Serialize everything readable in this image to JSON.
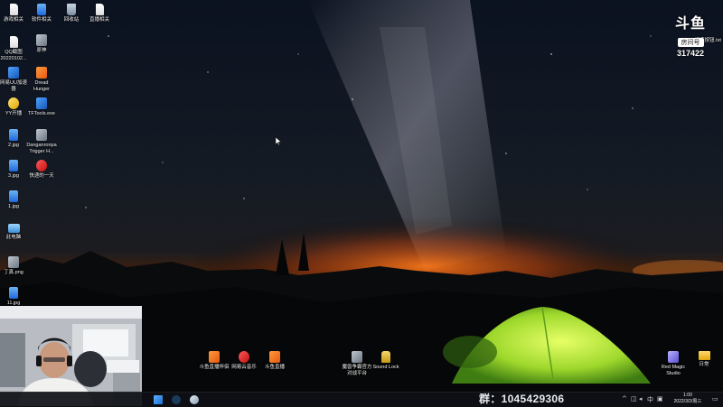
{
  "desktop": {
    "icons_left": [
      {
        "label": "游戏相关",
        "icon": "file-icon",
        "kind": "file"
      },
      {
        "label": "软件相关",
        "icon": "file-icon",
        "kind": "img"
      },
      {
        "label": "回收站",
        "icon": "recycle-bin-icon",
        "kind": "bin"
      },
      {
        "label": "直播相关",
        "icon": "file-icon",
        "kind": "file"
      },
      {
        "label": "QQ截图20220102...",
        "icon": "image-file-icon",
        "kind": "file"
      },
      {
        "label": "原神",
        "icon": "game-icon",
        "kind": "gray"
      },
      {
        "label": "网易UU加速器",
        "icon": "app-icon",
        "kind": "app"
      },
      {
        "label": "Dread Hunger",
        "icon": "game-icon",
        "kind": "orange"
      },
      {
        "label": "YY开播",
        "icon": "app-icon",
        "kind": "yellow"
      },
      {
        "label": "TFTools.exe",
        "icon": "app-icon",
        "kind": "app"
      },
      {
        "label": "2.jpg",
        "icon": "image-file-icon",
        "kind": "img"
      },
      {
        "label": "Danganronpa Trigger H...",
        "icon": "game-icon",
        "kind": "gray"
      },
      {
        "label": "3.jpg",
        "icon": "image-file-icon",
        "kind": "img"
      },
      {
        "label": "快递的一天",
        "icon": "app-icon",
        "kind": "red"
      },
      {
        "label": "1.jpg",
        "icon": "image-file-icon",
        "kind": "img"
      },
      {
        "label": "此电脑",
        "icon": "this-pc-icon",
        "kind": "pc"
      },
      {
        "label": "丁真.png",
        "icon": "image-file-icon",
        "kind": "gray"
      },
      {
        "label": "11.jpg",
        "icon": "image-file-icon",
        "kind": "img"
      }
    ],
    "icons_bottom": [
      {
        "label": "斗鱼直播伴侣",
        "icon": "app-icon",
        "kind": "orange"
      },
      {
        "label": "网易云音乐",
        "icon": "app-icon",
        "kind": "red"
      },
      {
        "label": "斗鱼直播",
        "icon": "app-icon",
        "kind": "orange"
      },
      {
        "label": "魔兽争霸官方对战平台",
        "icon": "app-icon",
        "kind": "gray"
      },
      {
        "label": "Sound Lock",
        "icon": "lock-icon",
        "kind": "lock"
      }
    ],
    "icons_right": [
      {
        "label": "Red Magic Studio",
        "icon": "app-icon",
        "kind": "purple"
      },
      {
        "label": "日常",
        "icon": "folder-icon",
        "kind": "folder"
      }
    ],
    "top_right_file": {
      "label": "...打造按钮.txt",
      "icon": "text-file-icon"
    }
  },
  "watermark": {
    "logo": "斗鱼",
    "room_label": "房间号",
    "room_number": "317422"
  },
  "overlay": {
    "group_text": "群：1045429306"
  },
  "taskbar": {
    "pinned": [
      {
        "name": "start-button",
        "icon": "windows-icon"
      },
      {
        "name": "steam-button",
        "icon": "steam-icon"
      },
      {
        "name": "edge-button",
        "icon": "browser-icon"
      },
      {
        "name": "app-button",
        "icon": "app-icon"
      }
    ],
    "tray": {
      "ime": "中",
      "chevron": "^"
    },
    "clock": {
      "time": "1:00",
      "date": "2022/3/2/周三"
    }
  },
  "colors": {
    "tent": "#b8f03a",
    "horizon_glow": "#ff7a1a",
    "sky_top": "#0b1220"
  }
}
